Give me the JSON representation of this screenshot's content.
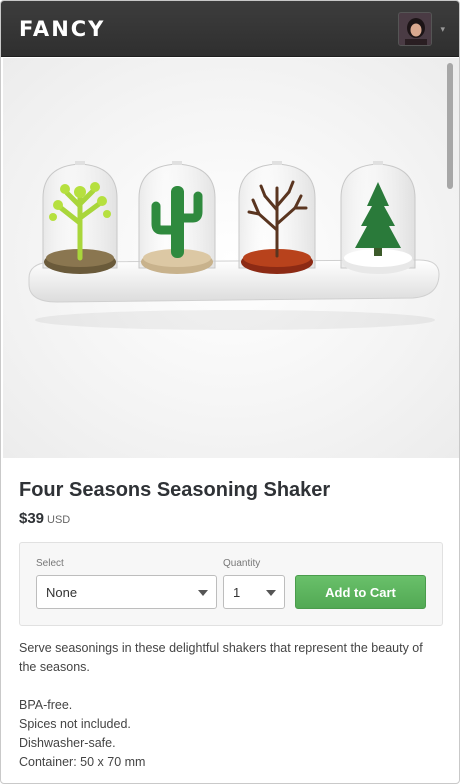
{
  "header": {
    "logo": "FANCY",
    "caret": "▾"
  },
  "product": {
    "title": "Four Seasons Seasoning Shaker",
    "price": "$39",
    "currency": "USD",
    "thumbnails": [
      "thumbnail-1",
      "thumbnail-2",
      "thumbnail-3"
    ]
  },
  "buybox": {
    "select_label": "Select",
    "select_value": "None",
    "quantity_label": "Quantity",
    "quantity_value": "1",
    "add_to_cart": "Add to Cart"
  },
  "description": {
    "intro": "Serve seasonings in these delightful shakers that represent the beauty of the seasons.",
    "features": [
      "BPA-free.",
      "Spices not included.",
      "Dishwasher-safe.",
      "Container: 50 x 70 mm"
    ]
  },
  "colors": {
    "header_bg": "#333333",
    "cart_button": "#5cb85c"
  }
}
